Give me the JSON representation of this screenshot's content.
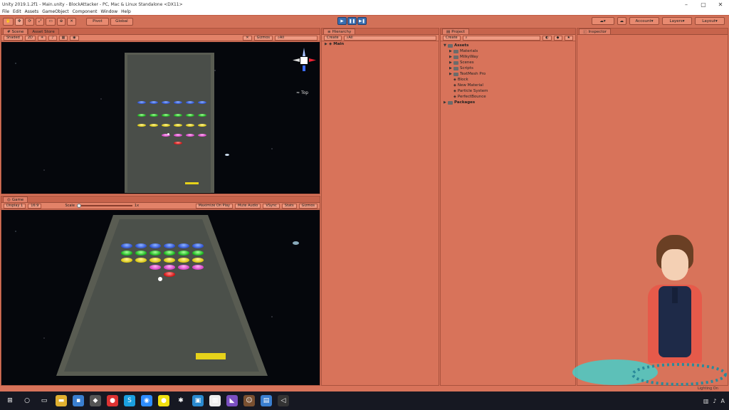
{
  "window": {
    "title": "Unity 2019.1.2f1 - Main.unity - BlockAttacker - PC, Mac & Linux Standalone <DX11>"
  },
  "menu": [
    "File",
    "Edit",
    "Assets",
    "GameObject",
    "Component",
    "Window",
    "Help"
  ],
  "toolbar": {
    "pivot": "Pivot",
    "global": "Global",
    "account": "Account",
    "layers": "Layers",
    "layout": "Layout"
  },
  "scene": {
    "tab": "Scene",
    "tab2": "Asset Store",
    "shading": "Shaded",
    "mode2d": "2D",
    "gizmos": "Gizmos",
    "search_placeholder": "All",
    "orientation": "Top"
  },
  "game": {
    "tab": "Game",
    "display": "Display 1",
    "aspect": "16:9",
    "scale_label": "Scale",
    "scale_value": "1x",
    "maximize": "Maximize On Play",
    "mute": "Mute Audio",
    "vsync": "VSync",
    "stats": "Stats",
    "gizmos": "Gizmos"
  },
  "hierarchy": {
    "tab": "Hierarchy",
    "create": "Create",
    "search_placeholder": "All",
    "root": "Main"
  },
  "project": {
    "tab": "Project",
    "create": "Create",
    "items": [
      {
        "label": "Assets",
        "level": 0,
        "bold": true,
        "folder": true,
        "arrow": "▼"
      },
      {
        "label": "Materials",
        "level": 1,
        "folder": true,
        "arrow": "▶"
      },
      {
        "label": "MilkyWay",
        "level": 1,
        "folder": true,
        "arrow": "▶"
      },
      {
        "label": "Scenes",
        "level": 1,
        "folder": true,
        "arrow": "▶"
      },
      {
        "label": "Scripts",
        "level": 1,
        "folder": true,
        "arrow": "▶"
      },
      {
        "label": "TextMesh Pro",
        "level": 1,
        "folder": true,
        "arrow": "▶"
      },
      {
        "label": "Block",
        "level": 1,
        "folder": false,
        "arrow": ""
      },
      {
        "label": "New Material",
        "level": 1,
        "folder": false,
        "arrow": ""
      },
      {
        "label": "Particle System",
        "level": 1,
        "folder": false,
        "arrow": ""
      },
      {
        "label": "PerfectBounce",
        "level": 1,
        "folder": false,
        "arrow": ""
      },
      {
        "label": "Packages",
        "level": 0,
        "bold": true,
        "folder": true,
        "arrow": "▶"
      }
    ]
  },
  "inspector": {
    "tab": "Inspector"
  },
  "status": {
    "text": "Lighting On"
  },
  "taskbar": {
    "icons": [
      {
        "name": "windows-start-icon",
        "glyph": "⊞",
        "color": "#161822"
      },
      {
        "name": "search-icon",
        "glyph": "○",
        "color": "#161822"
      },
      {
        "name": "task-view-icon",
        "glyph": "▭",
        "color": "#161822"
      },
      {
        "name": "file-explorer-icon",
        "glyph": "▬",
        "color": "#e0b030"
      },
      {
        "name": "app-icon",
        "glyph": "▪",
        "color": "#3a7fd0"
      },
      {
        "name": "unity-icon",
        "glyph": "◆",
        "color": "#555"
      },
      {
        "name": "chrome-icon",
        "glyph": "●",
        "color": "#d33"
      },
      {
        "name": "skype-icon",
        "glyph": "S",
        "color": "#1ba0e0"
      },
      {
        "name": "camera-icon",
        "glyph": "◉",
        "color": "#2d8cff"
      },
      {
        "name": "circle-app-icon",
        "glyph": "●",
        "color": "#f0e010"
      },
      {
        "name": "star-app-icon",
        "glyph": "✱",
        "color": "#161822"
      },
      {
        "name": "photos-icon",
        "glyph": "▣",
        "color": "#2a8ad0"
      },
      {
        "name": "window-app-icon",
        "glyph": "▦",
        "color": "#eee"
      },
      {
        "name": "visual-studio-icon",
        "glyph": "◣",
        "color": "#7b4fc0"
      },
      {
        "name": "avatar-app-icon",
        "glyph": "☺",
        "color": "#7a5030"
      },
      {
        "name": "store-icon",
        "glyph": "▤",
        "color": "#3a7fd0"
      },
      {
        "name": "unity-hub-icon",
        "glyph": "◁",
        "color": "#333"
      }
    ]
  }
}
